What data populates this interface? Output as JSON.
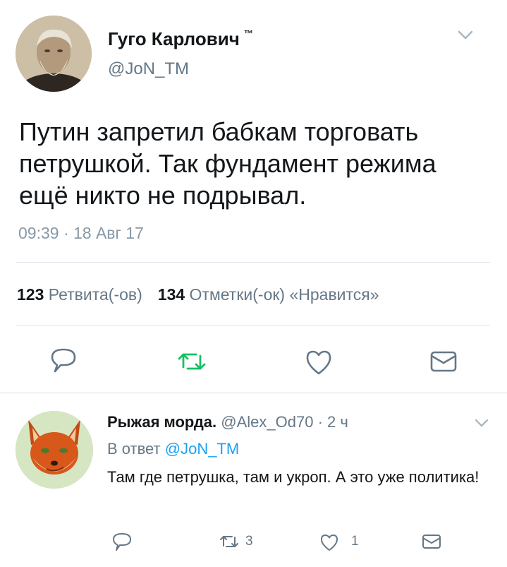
{
  "tweet": {
    "author_name": "Гуго Карлович",
    "author_badge": "™",
    "author_handle": "@JoN_TM",
    "text": "Путин запретил бабкам торговать петрушкой. Так фундамент режима ещё никто не подрывал.",
    "timestamp": "09:39 · 18 Авг 17",
    "stats": {
      "retweets_count": "123",
      "retweets_label": "Ретвита(-ов)",
      "likes_count": "134",
      "likes_label": "Отметки(-ок) «Нравится»"
    },
    "retweet_color": "#17bf63"
  },
  "reply": {
    "author_name": "Рыжая морда.",
    "author_handle": "@Alex_Od70",
    "time": "· 2 ч",
    "in_reply_to_prefix": "В ответ",
    "in_reply_to_handle": "@JoN_TM",
    "text": "Там где петрушка, там и укроп. А это уже политика!",
    "retweets": "3",
    "likes": "1"
  },
  "colors": {
    "text": "#14171a",
    "secondary": "#657786",
    "link": "#1da1f2",
    "retweet": "#17bf63"
  },
  "icons": {
    "reply": "speech-bubble",
    "retweet": "retweet-arrows",
    "like": "heart",
    "message": "envelope",
    "menu": "chevron-down"
  }
}
